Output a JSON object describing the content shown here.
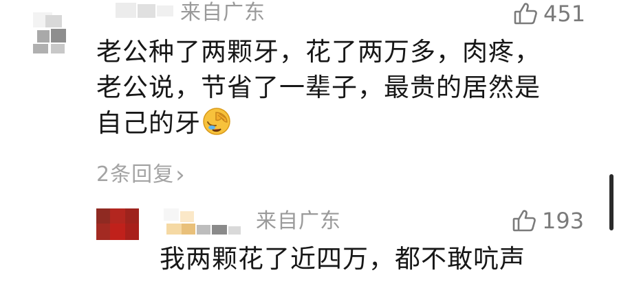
{
  "comment": {
    "location": "来自广东",
    "likes": "451",
    "lines": [
      "老公种了两颗牙，花了两万多，肉疼，",
      "老公说，节省了一辈子，最贵的居然是",
      "自己的牙"
    ],
    "emoji": "facepalm-laughing-emoji",
    "replies_label": "2条回复",
    "replies_chevron": "›"
  },
  "reply": {
    "location": "来自广东",
    "likes": "193",
    "text": "我两颗花了近四万，都不敢吭声"
  },
  "colors": {
    "text": "#171717",
    "meta": "#9a9a9a",
    "icon": "#7a7a7a",
    "avatar_red": "#a3201f"
  }
}
